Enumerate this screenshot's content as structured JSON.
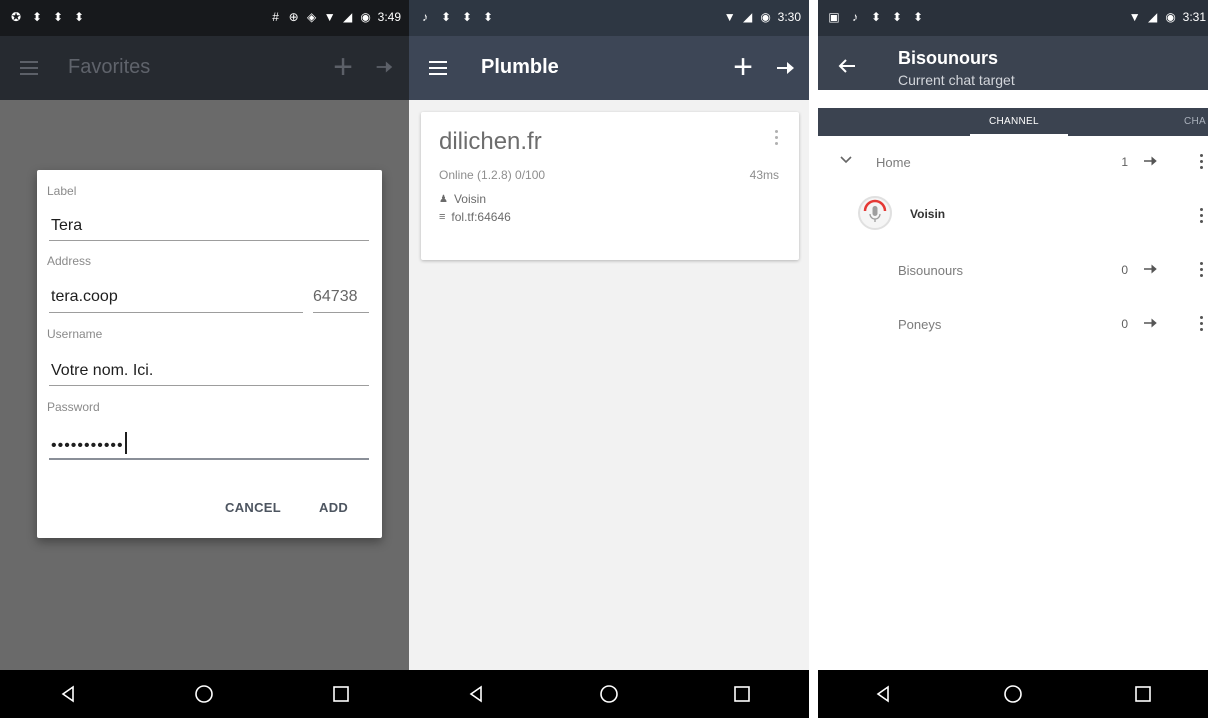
{
  "colors": {
    "dim_overlay": "#6a6a6a",
    "toolbar_primary": "#3d4656",
    "statusbar_primary": "#2e3743",
    "talk_indicator": "#e53935",
    "card_background": "#ffffff"
  },
  "screen1": {
    "status_time": "3:49",
    "toolbar_title": "Favorites",
    "dialog": {
      "label_label": "Label",
      "label_value": "Tera",
      "address_label": "Address",
      "address_value": "tera.coop",
      "port_value": "64738",
      "username_label": "Username",
      "username_value": "Votre nom. Ici.",
      "password_label": "Password",
      "password_value": "•••••••••••",
      "cancel_label": "CANCEL",
      "add_label": "ADD"
    }
  },
  "screen2": {
    "status_time": "3:30",
    "toolbar_title": "Plumble",
    "server": {
      "host": "dilichen.fr",
      "status": "Online (1.2.8)  0/100",
      "ping": "43ms",
      "username": "Voisin",
      "address": "fol.tf:64646"
    }
  },
  "screen3": {
    "status_time": "3:31",
    "title": "Bisounours",
    "subtitle": "Current chat target",
    "tabs": [
      "CHANNEL",
      "CHA"
    ],
    "channels": [
      {
        "name": "Home",
        "count": "1"
      },
      {
        "name": "Bisounours",
        "count": "0"
      },
      {
        "name": "Poneys",
        "count": "0"
      }
    ],
    "user": "Voisin"
  }
}
